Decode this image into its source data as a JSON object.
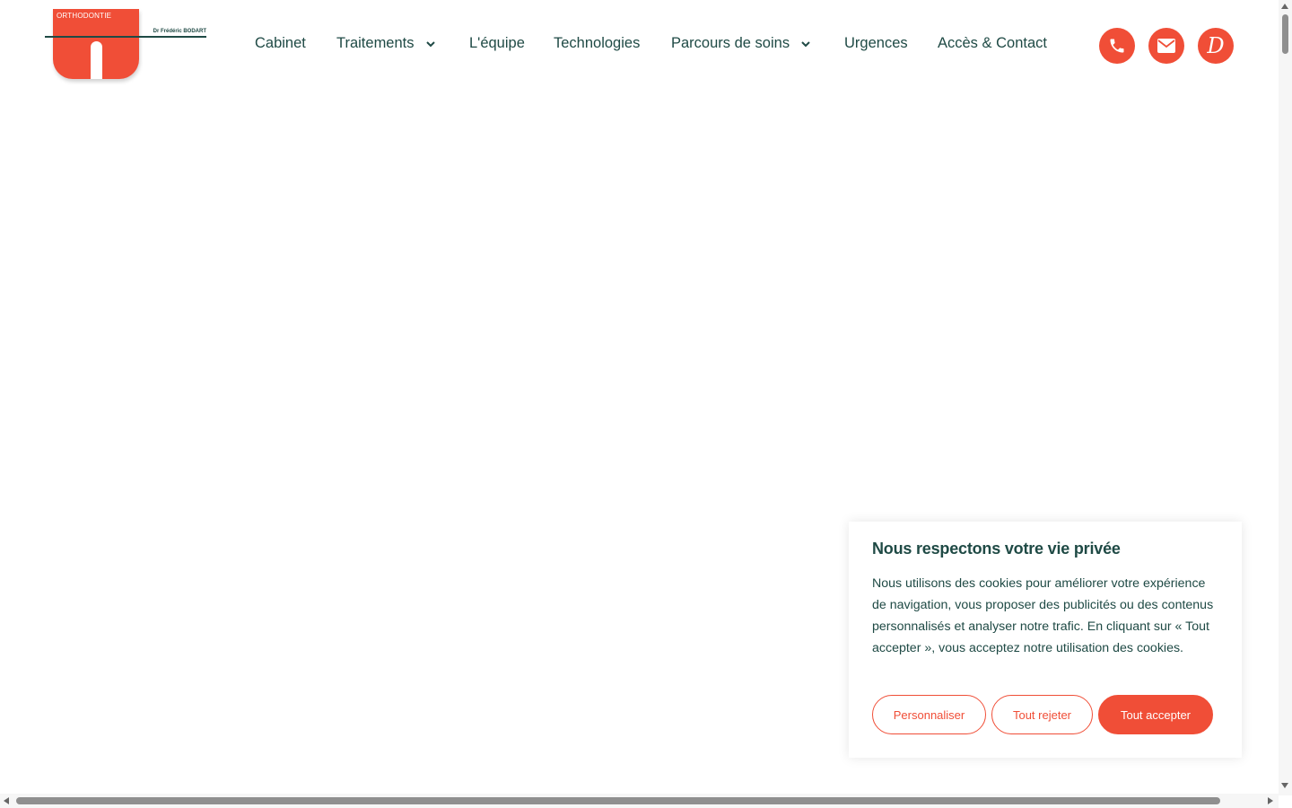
{
  "logo": {
    "top_text": "ORTHODONTIE",
    "name": "Dr Frédéric BODART"
  },
  "nav": {
    "items": [
      {
        "label": "Cabinet",
        "has_dropdown": false
      },
      {
        "label": "Traitements",
        "has_dropdown": true
      },
      {
        "label": "L'équipe",
        "has_dropdown": false
      },
      {
        "label": "Technologies",
        "has_dropdown": false
      },
      {
        "label": "Parcours de soins",
        "has_dropdown": true
      },
      {
        "label": "Urgences",
        "has_dropdown": false
      },
      {
        "label": "Accès & Contact",
        "has_dropdown": false
      }
    ]
  },
  "header_icons": [
    {
      "icon": "phone-icon"
    },
    {
      "icon": "envelope-icon"
    },
    {
      "icon": "doctolib-icon",
      "glyph": "D"
    }
  ],
  "cookie": {
    "title": "Nous respectons votre vie privée",
    "text": "Nous utilisons des cookies pour améliorer votre expérience de navigation, vous proposer des publicités ou des contenus personnalisés et analyser notre trafic. En cliquant sur « Tout accepter », vous acceptez notre utilisation des cookies.",
    "customize_label": "Personnaliser",
    "reject_label": "Tout rejeter",
    "accept_label": "Tout accepter"
  },
  "colors": {
    "brand_red": "#f04e37",
    "text_green": "#1f4a45",
    "background": "#ffffff"
  }
}
